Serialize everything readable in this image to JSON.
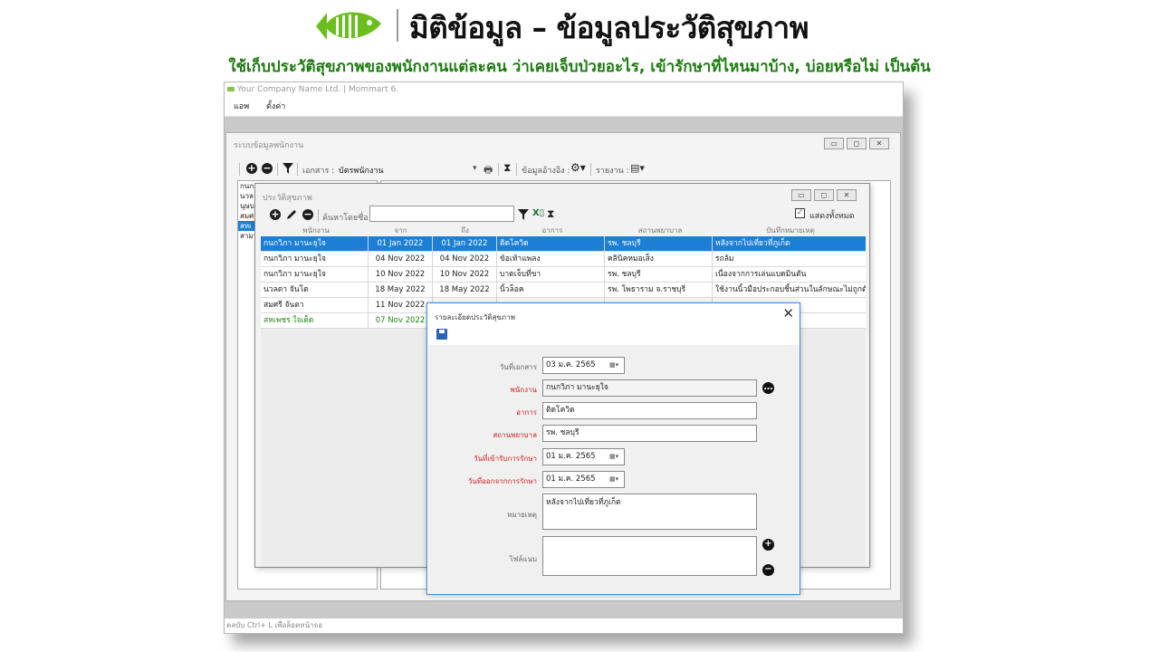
{
  "banner": {
    "title": "มิติข้อมูล – ข้อมูลประวัติสุขภาพ",
    "subtitle": "ใช้เก็บประวัติสุขภาพของพนักงานแต่ละคน ว่าเคยเจ็บป่วยอะไร, เข้ารักษาที่ไหนมาบ้าง, บ่อยหรือไม่ เป็นต้น",
    "logo_color": "#6abf1f"
  },
  "app": {
    "title": "Your Company Name Ltd. | Mommart 6.",
    "menu": [
      "แอพ",
      "ตั้งค่า"
    ],
    "status": "คลบับ Ctrl+ L เพื่อล็อคหน้าจอ"
  },
  "employee_window": {
    "title": "ระบบข้อมูลพนักงาน",
    "doc_label": "เอกสาร :",
    "doc_value": "บัตรพนักงาน",
    "reference_label": "ข้อมูลอ้างอิง :",
    "report_label": "รายงาน :",
    "list": [
      "กนก",
      "นวล",
      "นุษบ",
      "สมศ",
      "สหเ",
      "สามา"
    ],
    "selected_index": 4
  },
  "health_window": {
    "title": "ประวัติสุขภาพ",
    "search_label": "ค้นหาโดยชื่อ :",
    "search_value": "",
    "show_all_label": "แสดงทั้งหมด",
    "show_all_checked": true,
    "columns": [
      "พนักงาน",
      "จาก",
      "ถึง",
      "อาการ",
      "สถานพยาบาล",
      "บันทึกหมายเหตุ"
    ],
    "rows": [
      {
        "employee": "กนกวิภา มานะยุใจ",
        "from": "01 Jan 2022",
        "to": "01 Jan 2022",
        "symptom": "ติดโควิด",
        "hospital": "รพ. ชลบุรี",
        "note": "หลังจากไปเที่ยวที่ภูเก็ต",
        "state": "sel"
      },
      {
        "employee": "กนกวิภา มานะยุใจ",
        "from": "04 Nov 2022",
        "to": "04 Nov 2022",
        "symptom": "ข้อเท้าแพลง",
        "hospital": "คลินิคหมอเส็ง",
        "note": "รถล้ม",
        "state": ""
      },
      {
        "employee": "กนกวิภา มานะยุใจ",
        "from": "10 Nov 2022",
        "to": "10 Nov 2022",
        "symptom": "บาดเจ็บที่ขา",
        "hospital": "รพ. ชลบุรี",
        "note": "เนื่องจากการเล่นแบดมินตัน",
        "state": ""
      },
      {
        "employee": "นวลตา จันโต",
        "from": "18 May 2022",
        "to": "18 May 2022",
        "symptom": "นิ้วล็อค",
        "hospital": "รพ. โพธาราม จ.ราชบุรี",
        "note": "ใช้งานนิ้วมือประกอบชิ้นส่วนในลักษณะไม่ถูกต้...",
        "state": ""
      },
      {
        "employee": "สมศรี จันตา",
        "from": "11 Nov 2022",
        "to": "",
        "symptom": "",
        "hospital": "",
        "note": "",
        "state": ""
      },
      {
        "employee": "สหเพชร ใจเด็ด",
        "from": "07 Nov 2022",
        "to": "",
        "symptom": "",
        "hospital": "",
        "note": "",
        "state": "green"
      }
    ]
  },
  "detail_dialog": {
    "title": "รายละเอียดประวัติสุขภาพ",
    "fields": {
      "doc_date_label": "วันที่เอกสาร",
      "doc_date_value": "03 ม.ค.  2565",
      "employee_label": "พนักงาน",
      "employee_value": "กนกวิภา มานะยุใจ",
      "symptom_label": "อาการ",
      "symptom_value": "ติดโควิด",
      "hospital_label": "สถานพยาบาล",
      "hospital_value": "รพ. ชลบุรี",
      "admit_label": "วันที่เข้ารับการรักษา",
      "admit_value": "01 ม.ค.  2565",
      "discharge_label": "วันที่ออกจากการรักษา",
      "discharge_value": "01 ม.ค.  2565",
      "note_label": "หมายเหตุ",
      "note_value": "หลังจากไปเที่ยวที่ภูเก็ต",
      "attach_label": "ไฟล์แนบ"
    }
  }
}
